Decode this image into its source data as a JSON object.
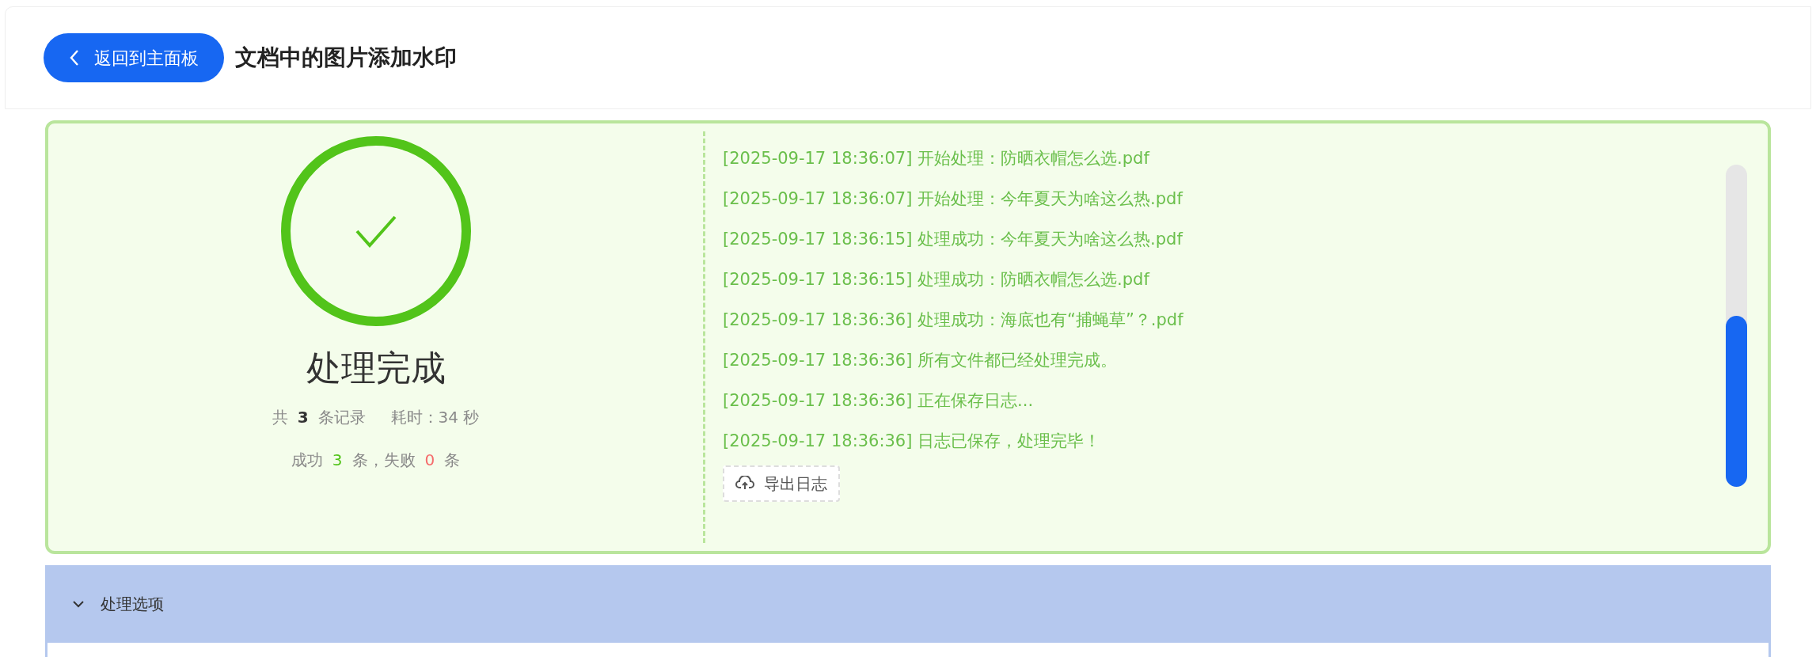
{
  "header": {
    "back_button": "返回到主面板",
    "title": "文档中的图片添加水印"
  },
  "result": {
    "succeeded": true,
    "title": "处理完成",
    "stats": [
      [
        {
          "kind": "text",
          "text": "共"
        },
        {
          "kind": "count",
          "text": "3"
        },
        {
          "kind": "text",
          "text": "条记录"
        },
        {
          "kind": "gap",
          "text": "耗时：34 秒"
        }
      ],
      [
        {
          "kind": "text",
          "text": "成功"
        },
        {
          "kind": "success",
          "text": "3"
        },
        {
          "kind": "text",
          "text": "条，失败"
        },
        {
          "kind": "fail",
          "text": "0"
        },
        {
          "kind": "text",
          "text": "条"
        }
      ]
    ]
  },
  "log": {
    "lines": [
      "[2025-09-17 18:36:07] 开始处理：防晒衣帽怎么选.pdf",
      "[2025-09-17 18:36:07] 开始处理：今年夏天为啥这么热.pdf",
      "[2025-09-17 18:36:15] 处理成功：今年夏天为啥这么热.pdf",
      "[2025-09-17 18:36:15] 处理成功：防晒衣帽怎么选.pdf",
      "[2025-09-17 18:36:36] 处理成功：海底也有“捕蝇草”？.pdf",
      "[2025-09-17 18:36:36] 所有文件都已经处理完成。",
      "[2025-09-17 18:36:36] 正在保存日志...",
      "[2025-09-17 18:36:36] 日志已保存，处理完毕！"
    ],
    "export_button": "导出日志"
  },
  "progress": {
    "level": 0.53
  },
  "options_panel": {
    "title": "处理选项",
    "expanded": true
  }
}
